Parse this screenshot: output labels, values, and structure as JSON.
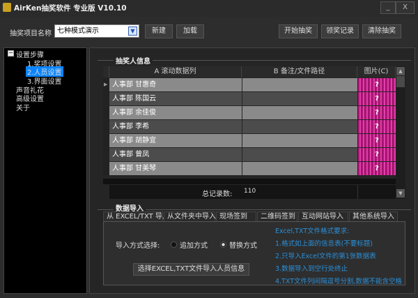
{
  "window": {
    "title": "AirKen抽奖软件 专业版 V10.10",
    "minimize": "_",
    "close": "X"
  },
  "toolbar": {
    "project_label": "抽奖项目名称",
    "project_value": "七种模式演示",
    "new": "新建",
    "load": "加载",
    "start": "开始抽奖",
    "records": "领奖记录",
    "clear": "清除抽奖"
  },
  "tree": {
    "root": "设置步骤",
    "toggle": "−",
    "items": [
      "1.奖项设置",
      "2.人员设置",
      "3.界面设置"
    ],
    "others": [
      "声音礼花",
      "高级设置",
      "关于"
    ],
    "selected": "2.人员设置"
  },
  "info": {
    "group": "抽奖人信息",
    "columns": [
      "A 滚动数据列",
      "B 备注/文件路径",
      "图片(C)"
    ],
    "rows": [
      {
        "a": "人事部 甘惠奇",
        "b": ""
      },
      {
        "a": "人事部 陈国云",
        "b": ""
      },
      {
        "a": "人事部 余佳俊",
        "b": ""
      },
      {
        "a": "人事部 李希",
        "b": ""
      },
      {
        "a": "人事部 胡静宜",
        "b": ""
      },
      {
        "a": "人事部 曾凤",
        "b": ""
      },
      {
        "a": "人事部 甘美琴",
        "b": ""
      }
    ],
    "pic_glyph": "?",
    "total_label": "总记录数:",
    "total": "110"
  },
  "import": {
    "group": "数据导入",
    "tabs": [
      "从 EXCEL/TXT 导入",
      "从文件夹中导入",
      "现场签到",
      "二维码签到",
      "互动网站导入",
      "其他系统导入"
    ],
    "mode_label": "导入方式选择:",
    "modes": [
      "追加方式",
      "替换方式"
    ],
    "selected_mode": "替换方式",
    "button": "选择EXCEL,TXT文件导入人员信息",
    "notes": [
      "Excel,TXT文件格式要求:",
      "1.格式如上面的信息表(不要标题)",
      "2.只导入Excel文件的第1张数据表",
      "3.数据导入到空行处终止",
      "4.TXT文件列间隔逗号分割,数据不能含空格"
    ]
  },
  "colors": {
    "accent": "#0a84ff",
    "pic": "#d0308f",
    "info_text": "#2a8fd8"
  }
}
